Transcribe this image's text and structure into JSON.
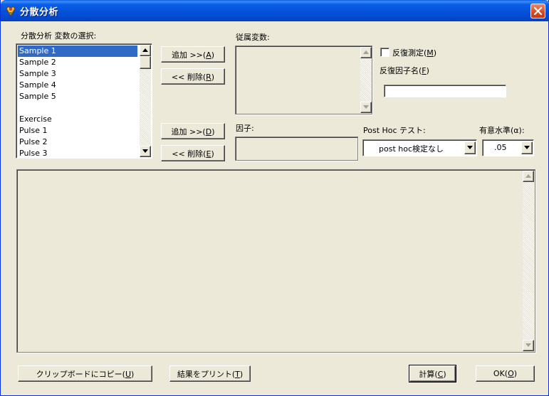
{
  "window": {
    "title": "分散分析",
    "app_icon": "app-icon",
    "close_icon": "close-icon"
  },
  "variable_select": {
    "label": "分散分析 変数の選択:",
    "items": [
      "Sample 1",
      "Sample 2",
      "Sample 3",
      "Sample 4",
      "Sample 5",
      "",
      "Exercise",
      "Pulse 1",
      "Pulse 2",
      "Pulse 3"
    ],
    "selected_index": 0
  },
  "buttons": {
    "add1_pre": "追加 >>(",
    "add1_key": "A",
    "add1_post": ")",
    "del1_pre": "<< 削除(",
    "del1_key": "R",
    "del1_post": ")",
    "add2_pre": "追加 >>(",
    "add2_key": "D",
    "add2_post": ")",
    "del2_pre": "<< 削除(",
    "del2_key": "E",
    "del2_post": ")",
    "copy_pre": "クリップボードにコピー(",
    "copy_key": "U",
    "copy_post": ")",
    "print_pre": "結果をプリント(",
    "print_key": "T",
    "print_post": ")",
    "calc_pre": "計算(",
    "calc_key": "C",
    "calc_post": ")",
    "ok_pre": "OK(",
    "ok_key": "O",
    "ok_post": ")"
  },
  "dependent": {
    "label": "従属変数:"
  },
  "repeated": {
    "checkbox_pre": "反復測定(",
    "checkbox_key": "M",
    "checkbox_post": ")",
    "checked": false,
    "factor_name_pre": "反復因子名(",
    "factor_name_key": "F",
    "factor_name_post": ")",
    "factor_name_value": ""
  },
  "factor": {
    "label": "因子:"
  },
  "posthoc": {
    "label": "Post Hoc テスト:",
    "value": "post hoc検定なし"
  },
  "alpha": {
    "label": "有意水準(α):",
    "value": ".05"
  },
  "colors": {
    "title_bar": "#0a5fe8",
    "selection": "#316ac5",
    "dialog_bg": "#ece9d8",
    "close_button": "#d24b22"
  }
}
